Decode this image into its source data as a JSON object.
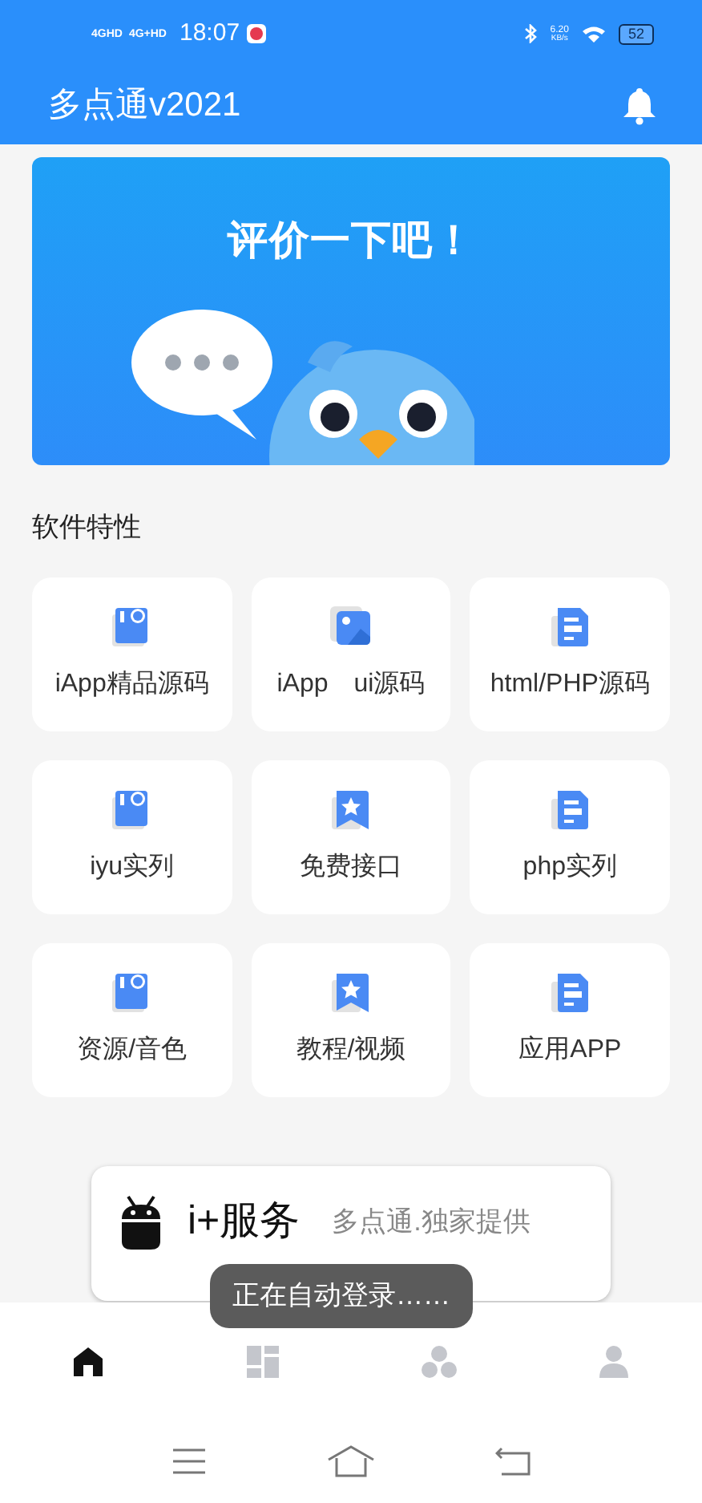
{
  "status_bar": {
    "network_1": "4GHD",
    "network_2": "4G+HD",
    "time": "18:07",
    "speed": "6.20",
    "speed_unit": "KB/s",
    "battery": "52"
  },
  "header": {
    "title": "多点通v2021"
  },
  "banner": {
    "title": "评价一下吧！"
  },
  "section": {
    "title": "软件特性"
  },
  "features": [
    {
      "label": "iApp精品源码",
      "kind": "code"
    },
    {
      "label": "iApp　ui源码",
      "kind": "image"
    },
    {
      "label": "html/PHP源码",
      "kind": "doc"
    },
    {
      "label": "iyu实列",
      "kind": "code"
    },
    {
      "label": "免费接口",
      "kind": "star"
    },
    {
      "label": "php实列",
      "kind": "doc"
    },
    {
      "label": "资源/音色",
      "kind": "code"
    },
    {
      "label": "教程/视频",
      "kind": "star"
    },
    {
      "label": "应用APP",
      "kind": "doc"
    }
  ],
  "service": {
    "title": "i+服务",
    "tagline": "多点通.独家提供"
  },
  "toast": "正在自动登录……",
  "tabs": [
    {
      "kind": "home",
      "selected": true
    },
    {
      "kind": "dashboard",
      "selected": false
    },
    {
      "kind": "group",
      "selected": false
    },
    {
      "kind": "user",
      "selected": false
    }
  ]
}
